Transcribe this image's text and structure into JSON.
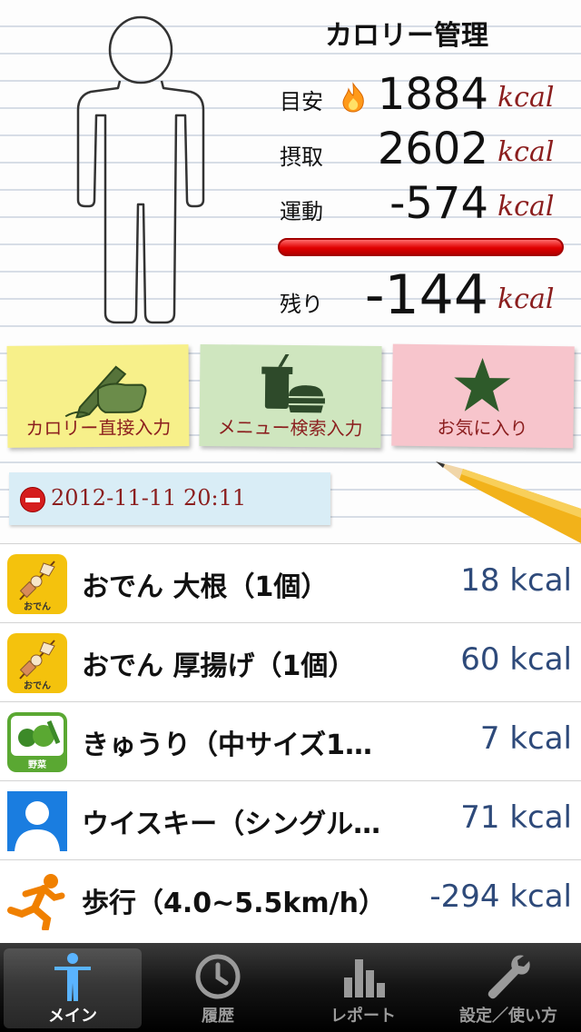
{
  "header": {
    "title": "カロリー管理"
  },
  "summary": {
    "target_label": "目安",
    "target_value": "1884",
    "intake_label": "摂取",
    "intake_value": "2602",
    "exercise_label": "運動",
    "exercise_value": "-574",
    "remaining_label": "残り",
    "remaining_value": "-144",
    "unit": "kcal"
  },
  "notes": [
    {
      "label": "カロリー直接入力",
      "color": "#f7f08a"
    },
    {
      "label": "メニュー検索入力",
      "color": "#cfe6bf"
    },
    {
      "label": "お気に入り",
      "color": "#f7c5cc"
    }
  ],
  "date": "2012-11-11 20:11",
  "entries": [
    {
      "name": "おでん 大根（1個）",
      "kcal": "18 kcal",
      "icon": "oden-icon",
      "icon_text": "おでん"
    },
    {
      "name": "おでん 厚揚げ（1個）",
      "kcal": "60 kcal",
      "icon": "oden-icon",
      "icon_text": "おでん"
    },
    {
      "name": "きゅうり（中サイズ1…",
      "kcal": "7 kcal",
      "icon": "vegetable-icon",
      "icon_text": "野菜"
    },
    {
      "name": "ウイスキー（シングル…",
      "kcal": "71 kcal",
      "icon": "person-silhouette-icon"
    },
    {
      "name": "歩行（4.0~5.5km/h）",
      "kcal": "-294 kcal",
      "icon": "running-icon"
    }
  ],
  "tabs": [
    {
      "label": "メイン",
      "icon": "person-icon"
    },
    {
      "label": "履歴",
      "icon": "clock-icon"
    },
    {
      "label": "レポート",
      "icon": "bar-chart-icon"
    },
    {
      "label": "設定／使い方",
      "icon": "wrench-icon"
    }
  ],
  "colors": {
    "unit": "#8b1e1e",
    "kcal": "#2e4a7a",
    "bar": "#e00000"
  }
}
